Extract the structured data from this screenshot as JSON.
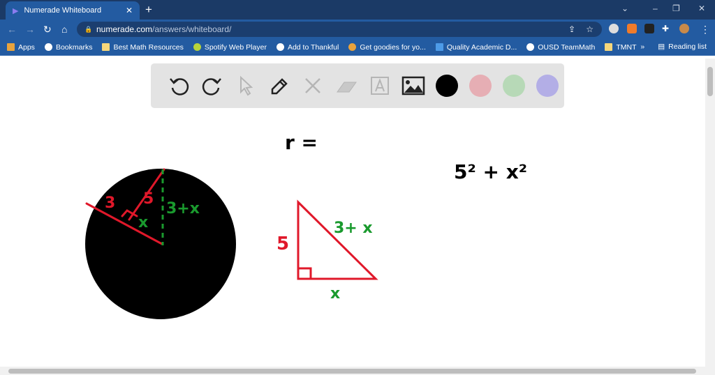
{
  "browser": {
    "tab_title": "Numerade Whiteboard",
    "url_domain": "numerade.com",
    "url_path": "/answers/whiteboard/",
    "bookmarks": [
      {
        "label": "Apps",
        "icon": "apps-grid-icon",
        "color": "#e8a33d"
      },
      {
        "label": "Bookmarks",
        "icon": "star-icon",
        "color": "#ffffff"
      },
      {
        "label": "Best Math Resources",
        "icon": "folder-icon",
        "color": "#f6d77b"
      },
      {
        "label": "Spotify Web Player",
        "icon": "spotify-icon",
        "color": "#b7d33a"
      },
      {
        "label": "Add to Thankful",
        "icon": "globe-icon",
        "color": "#ffffff"
      },
      {
        "label": "Get goodies for yo...",
        "icon": "chrome-icon",
        "color": "#e9a23b"
      },
      {
        "label": "Quality Academic D...",
        "icon": "doc-icon",
        "color": "#4d9be8"
      },
      {
        "label": "OUSD TeamMath",
        "icon": "globe-icon",
        "color": "#ffffff"
      },
      {
        "label": "TMNT",
        "icon": "folder-icon",
        "color": "#f6d77b"
      }
    ],
    "overflow": "»",
    "reading_list": "Reading list"
  },
  "whiteboard": {
    "tools": [
      "undo",
      "redo",
      "select",
      "pen",
      "tools",
      "eraser",
      "text",
      "image"
    ],
    "colors": [
      "#000000",
      "#e6aeb4",
      "#b7d9b7",
      "#b3aee6"
    ],
    "drawing_labels": {
      "r_equals": "r =",
      "equation": "5² + x²",
      "circle_3": "3",
      "circle_5": "5",
      "circle_x": "x",
      "circle_3x": "3+x",
      "tri_5": "5",
      "tri_3x": "3+ x",
      "tri_x": "x"
    },
    "ink": {
      "red": "#e0182a",
      "green": "#1a9a2e",
      "black": "#000000"
    }
  }
}
